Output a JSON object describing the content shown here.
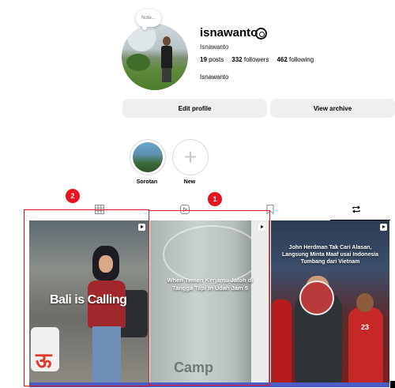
{
  "profile": {
    "note_label": "Note...",
    "username": "isnawanto",
    "full_name": "Isnawanto",
    "stats": {
      "posts": "19",
      "posts_label": "posts",
      "followers": "332",
      "followers_label": "followers",
      "following": "462",
      "following_label": "following"
    },
    "bio": "Isnawanto",
    "icons": {
      "settings": "gear-icon"
    }
  },
  "buttons": {
    "edit_profile": "Edit profile",
    "view_archive": "View archive"
  },
  "highlights": [
    {
      "label": "Sorotan"
    },
    {
      "label": "New"
    }
  ],
  "tabs": [
    {
      "name": "posts-grid",
      "icon": "grid-icon",
      "active": false
    },
    {
      "name": "reels",
      "icon": "reels-icon",
      "active": false
    },
    {
      "name": "saved",
      "icon": "bookmark-icon",
      "active": false
    },
    {
      "name": "reposts",
      "icon": "repost-icon",
      "active": true
    }
  ],
  "posts": [
    {
      "caption": "Bali is Calling",
      "type": "reel"
    },
    {
      "caption": "When Temen Kerjamu Jatoh di Tangga Tapi In Udah Jam 5",
      "type": "reel",
      "watermark": "Camp"
    },
    {
      "caption": "John Herdman Tak Cari Alasan, Langsung Minta Maaf usai Indonesia Tumbang dari Vietnam",
      "type": "reel",
      "jersey_number": "23"
    }
  ],
  "annotations": [
    {
      "label": "1",
      "color": "#e8141f"
    },
    {
      "label": "2",
      "color": "#e8141f"
    }
  ]
}
